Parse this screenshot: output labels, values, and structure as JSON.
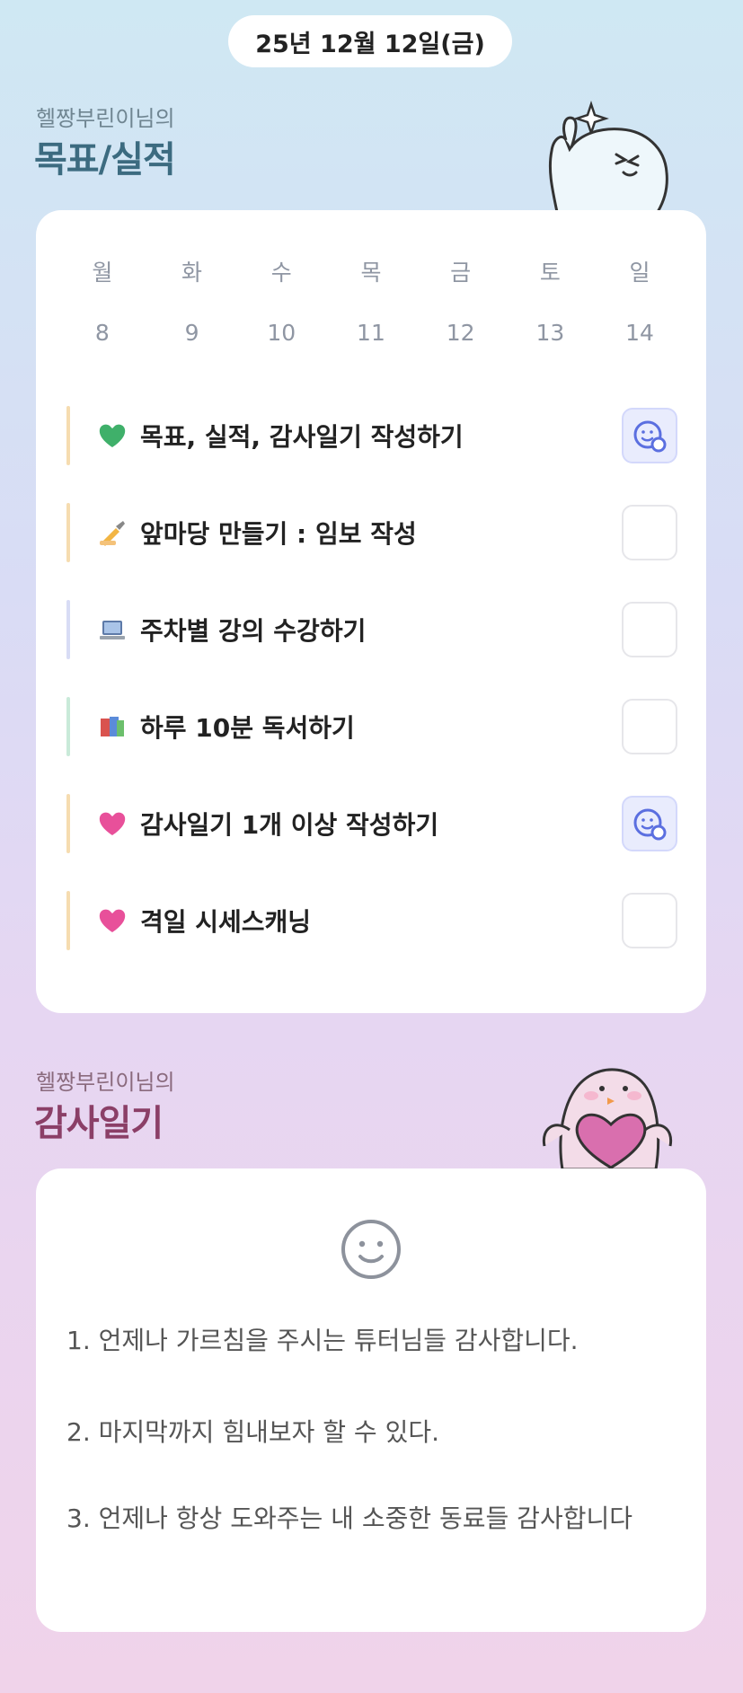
{
  "header": {
    "date": "25년 12월 12일(금)"
  },
  "goals_section": {
    "subtitle": "헬짱부린이님의",
    "title": "목표/실적"
  },
  "week": {
    "days": [
      "월",
      "화",
      "수",
      "목",
      "금",
      "토",
      "일"
    ],
    "dates": [
      "8",
      "9",
      "10",
      "11",
      "12",
      "13",
      "14"
    ]
  },
  "goals": [
    {
      "emoji": "green-heart-icon",
      "label": "목표, 실적, 감사일기 작성하기",
      "accent": "#f6dcb0",
      "done": true
    },
    {
      "emoji": "writing-hand-icon",
      "label": "앞마당 만들기 : 임보 작성",
      "accent": "#f6dcb0",
      "done": false
    },
    {
      "emoji": "laptop-icon",
      "label": "주차별 강의 수강하기",
      "accent": "#d8dcf5",
      "done": false
    },
    {
      "emoji": "books-icon",
      "label": "하루 10분 독서하기",
      "accent": "#c9ead9",
      "done": false
    },
    {
      "emoji": "pink-heart-icon",
      "label": "감사일기 1개 이상 작성하기",
      "accent": "#f6dcb0",
      "done": true
    },
    {
      "emoji": "pink-heart-icon",
      "label": "격일 시세스캐닝",
      "accent": "#f6dcb0",
      "done": false
    }
  ],
  "diary_section": {
    "subtitle": "헬짱부린이님의",
    "title": "감사일기",
    "mood_icon": "smiley-face-icon",
    "entries": [
      "1. 언제나 가르침을 주시는 튜터님들 감사합니다.",
      "2. 마지막까지 힘내보자 할 수 있다.",
      "3. 언제나 항상 도와주는 내 소중한 동료들 감사합니다"
    ]
  },
  "colors": {
    "goals_title": "#3c6b80",
    "diary_title": "#8b3f67",
    "check_done_icon": "#5b6fe0"
  }
}
